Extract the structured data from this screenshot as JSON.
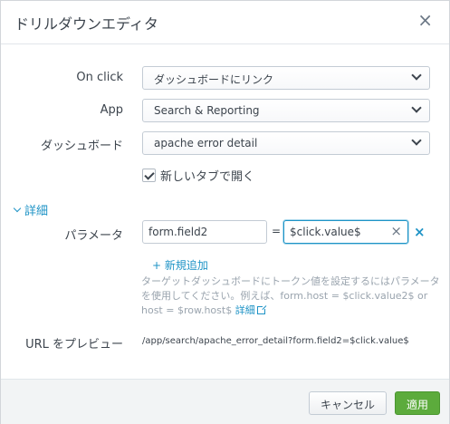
{
  "dialog": {
    "title": "ドリルダウンエディタ",
    "close_glyph": "×"
  },
  "form": {
    "on_click": {
      "label": "On click",
      "value": "ダッシュボードにリンク"
    },
    "app": {
      "label": "App",
      "value": "Search & Reporting"
    },
    "dashboard": {
      "label": "ダッシュボード",
      "value": "apache error detail"
    },
    "new_tab": {
      "label": "新しいタブで開く",
      "checked": true
    }
  },
  "details": {
    "toggle_label": "詳細",
    "params_label": "パラメータ",
    "param": {
      "name": "form.field2",
      "equals": "=",
      "value": "$click.value$"
    },
    "clear_glyph": "×",
    "remove_glyph": "×",
    "add_label": "+ 新規追加",
    "help_text": "ターゲットダッシュボードにトークン値を設定するにはパラメータを使用してください。例えば、form.host = $click.value2$ or host = $row.host$",
    "help_link": "詳細"
  },
  "preview": {
    "label": "URL をプレビュー",
    "url": "/app/search/apache_error_detail?form.field2=$click.value$"
  },
  "footer": {
    "cancel_label": "キャンセル",
    "apply_label": "適用"
  },
  "colors": {
    "accent": "#1e93c6",
    "apply": "#5cab3c"
  }
}
